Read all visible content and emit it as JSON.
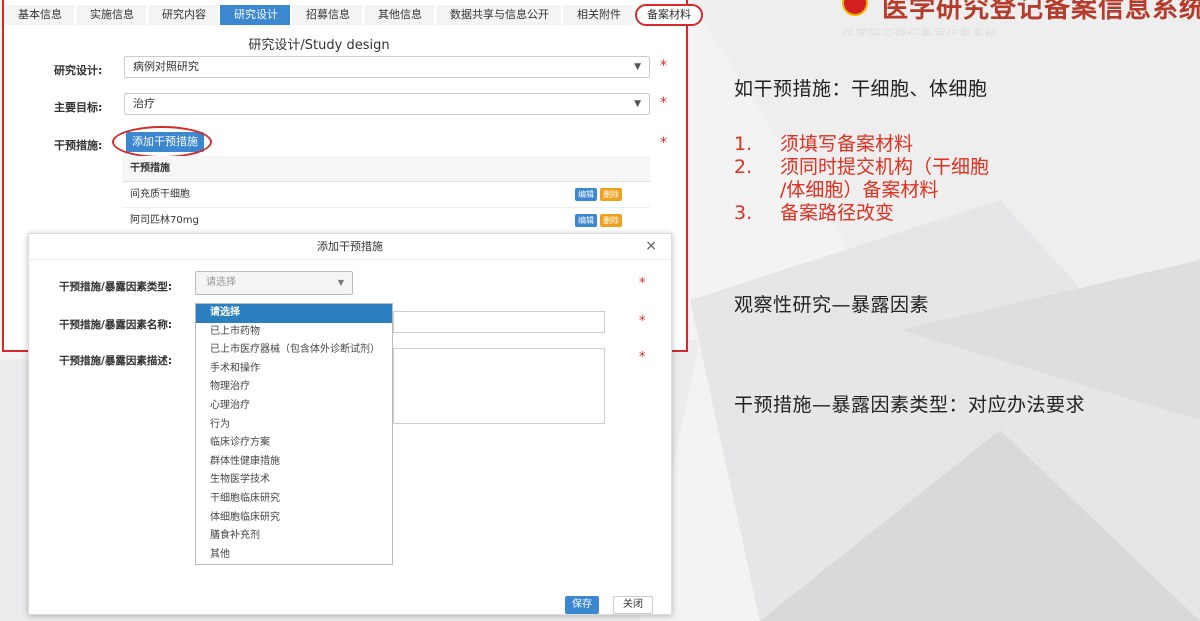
{
  "header": {
    "logo_text": "医学研究登记备案信息系统",
    "subline": "医学研究登记备案信息系统"
  },
  "tabs": [
    "基本信息",
    "实施信息",
    "研究内容",
    "研究设计",
    "招募信息",
    "其他信息",
    "数据共享与信息公开",
    "相关附件",
    "备案材料"
  ],
  "form": {
    "title": "研究设计/Study design",
    "study_design_label": "研究设计:",
    "study_design_value": "病例对照研究",
    "primary_goal_label": "主要目标:",
    "primary_goal_value": "治疗",
    "intervention_label": "干预措施:",
    "add_button": "添加干预措施",
    "table_header": "干预措施",
    "rows": [
      {
        "name": "间充质干细胞",
        "edit": "编辑",
        "delete": "删除"
      },
      {
        "name": "阿司匹林70mg",
        "edit": "编辑",
        "delete": "删除"
      }
    ]
  },
  "modal": {
    "title": "添加干预措施",
    "close": "×",
    "type_label": "干预措施/暴露因素类型:",
    "type_placeholder": "请选择",
    "name_label": "干预措施/暴露因素名称:",
    "desc_label": "干预措施/暴露因素描述:",
    "options": [
      "请选择",
      "已上市药物",
      "已上市医疗器械（包含体外诊断试剂）",
      "手术和操作",
      "物理治疗",
      "心理治疗",
      "行为",
      "临床诊疗方案",
      "群体性健康措施",
      "生物医学技术",
      "干细胞临床研究",
      "体细胞临床研究",
      "膳食补充剂",
      "其他"
    ],
    "save": "保存",
    "close_button": "关闭"
  },
  "notes": {
    "heading": "如干预措施：干细胞、体细胞",
    "steps": [
      {
        "num": "1.",
        "text": "须填写备案材料"
      },
      {
        "num": "2.",
        "text": "须同时提交机构（干细胞"
      },
      {
        "num": "",
        "text": "/体细胞）备案材料"
      },
      {
        "num": "3.",
        "text": "备案路径改变"
      }
    ],
    "observational": "观察性研究—暴露因素",
    "type_note": "干预措施—暴露因素类型：对应办法要求"
  },
  "colors": {
    "accent": "#3b87d0",
    "highlight": "#d42a2a",
    "step_text": "#e03020"
  }
}
